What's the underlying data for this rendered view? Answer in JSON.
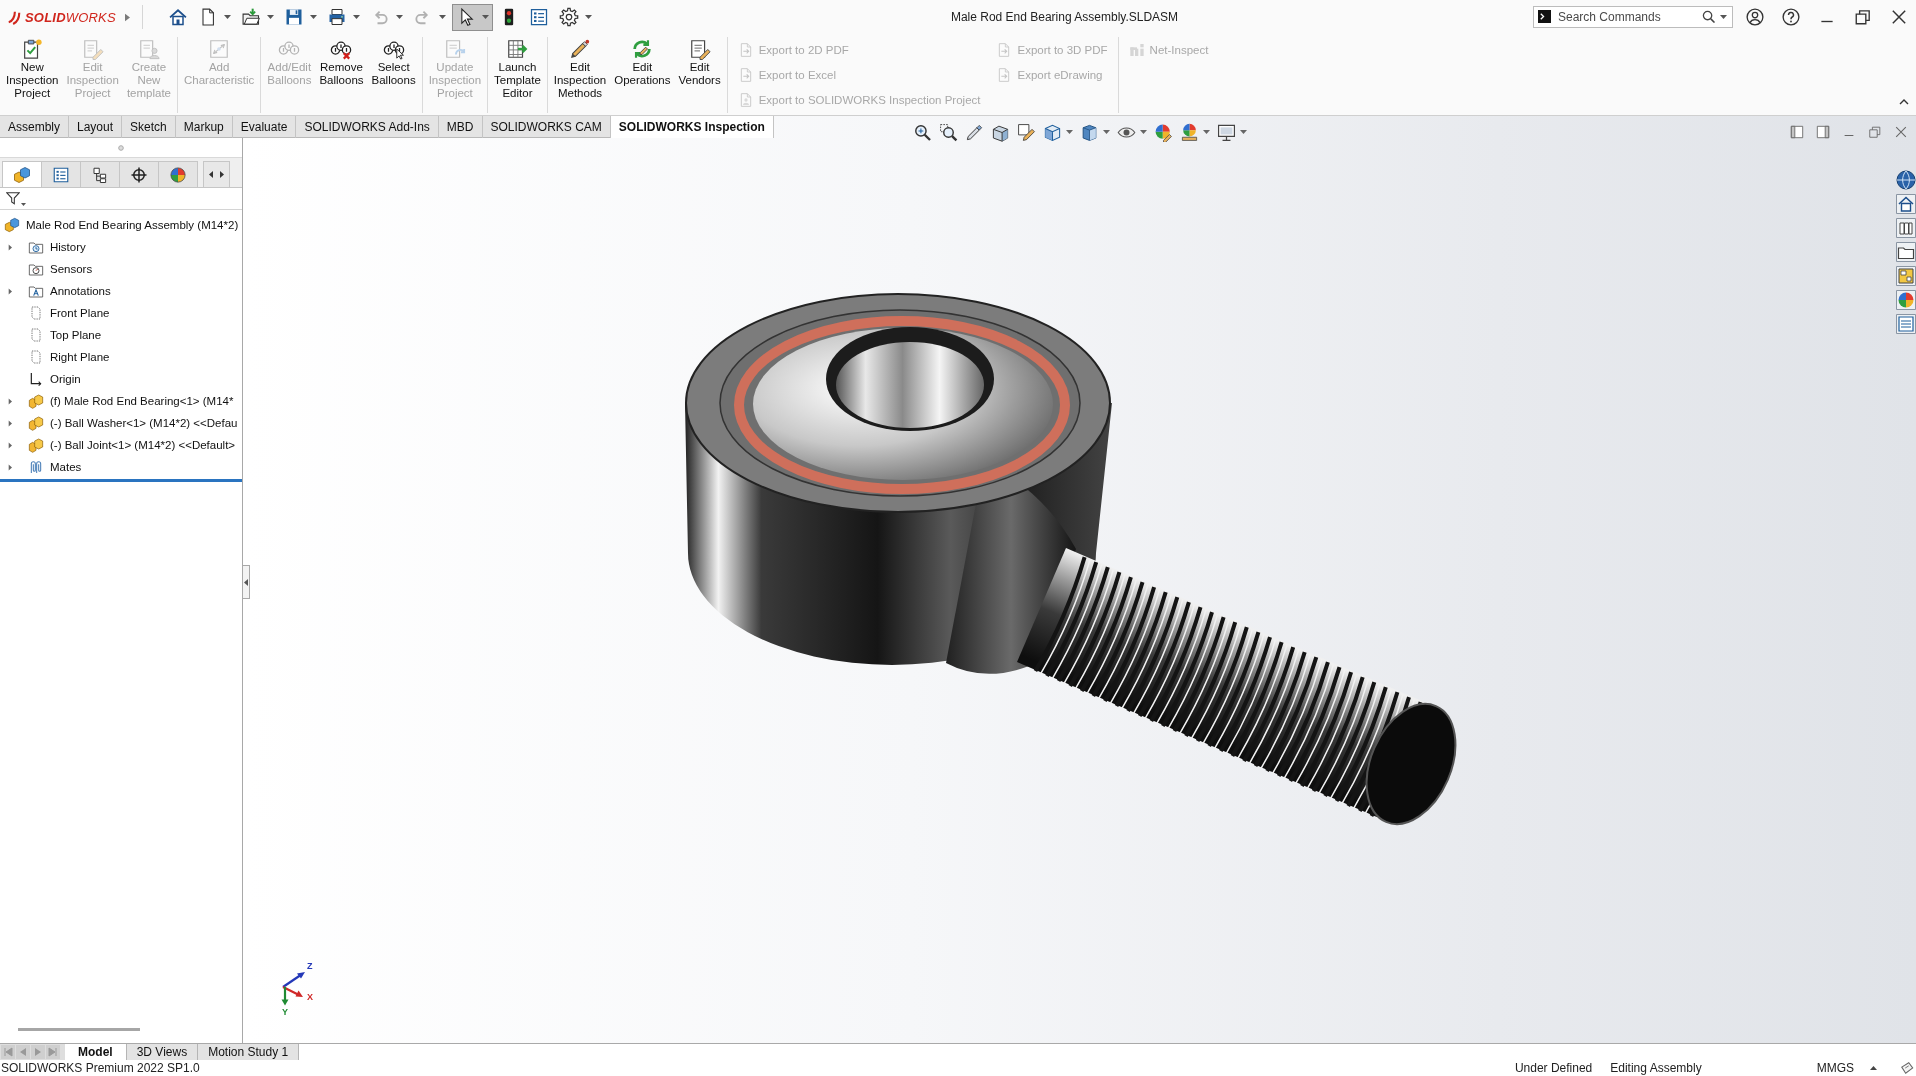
{
  "title_bar": {
    "logo": "**SOLID**WORKS",
    "title": "Male Rod End Bearing Assembly.SLDASM",
    "search": {
      "placeholder": "Search Commands"
    }
  },
  "quick_access": [
    {
      "kind": "home",
      "dropdown": false,
      "disabled": false,
      "selected": false
    },
    {
      "kind": "new",
      "dropdown": true,
      "disabled": false,
      "selected": false
    },
    {
      "kind": "open",
      "dropdown": true,
      "disabled": false,
      "selected": false
    },
    {
      "kind": "save",
      "dropdown": true,
      "disabled": false,
      "selected": false
    },
    {
      "kind": "print",
      "dropdown": true,
      "disabled": false,
      "selected": false
    },
    {
      "kind": "undo",
      "dropdown": true,
      "disabled": true,
      "selected": false
    },
    {
      "kind": "redo",
      "dropdown": true,
      "disabled": true,
      "selected": false
    },
    {
      "kind": "select",
      "dropdown": true,
      "disabled": false,
      "selected": true
    },
    {
      "kind": "rebuild",
      "dropdown": false,
      "disabled": false,
      "selected": false
    },
    {
      "kind": "properties",
      "dropdown": false,
      "disabled": false,
      "selected": false
    },
    {
      "kind": "options",
      "dropdown": true,
      "disabled": false,
      "selected": false
    }
  ],
  "ribbon": {
    "groups": [
      {
        "kind": "large",
        "buttons": [
          {
            "kind": "project",
            "lines": [
              "New",
              "Inspection",
              "Project"
            ],
            "disabled": false
          },
          {
            "kind": "edit",
            "lines": [
              "Edit",
              "Inspection",
              "Project"
            ],
            "disabled": true
          },
          {
            "kind": "template",
            "lines": [
              "Create",
              "New",
              "template"
            ],
            "disabled": true
          }
        ]
      },
      {
        "kind": "large",
        "buttons": [
          {
            "kind": "characteristic",
            "lines": [
              "Add",
              "Characteristic"
            ],
            "disabled": true
          }
        ]
      },
      {
        "kind": "large",
        "buttons": [
          {
            "kind": "balloons",
            "lines": [
              "Add/Edit",
              "Balloons"
            ],
            "disabled": true
          },
          {
            "kind": "remove",
            "lines": [
              "Remove",
              "Balloons"
            ],
            "disabled": false
          },
          {
            "kind": "select",
            "lines": [
              "Select",
              "Balloons"
            ],
            "disabled": false
          }
        ]
      },
      {
        "kind": "large",
        "buttons": [
          {
            "kind": "update",
            "lines": [
              "Update",
              "Inspection",
              "Project"
            ],
            "disabled": true
          }
        ]
      },
      {
        "kind": "large",
        "buttons": [
          {
            "kind": "launch",
            "lines": [
              "Launch",
              "Template",
              "Editor"
            ],
            "disabled": false
          }
        ]
      },
      {
        "kind": "large",
        "buttons": [
          {
            "kind": "methods",
            "lines": [
              "Edit",
              "Inspection",
              "Methods"
            ],
            "disabled": false
          },
          {
            "kind": "operations",
            "lines": [
              "Edit",
              "Operations"
            ],
            "disabled": false
          },
          {
            "kind": "vendors",
            "lines": [
              "Edit",
              "Vendors"
            ],
            "disabled": false
          }
        ]
      },
      {
        "kind": "small",
        "columns": [
          [
            {
              "kind": "pdf",
              "label": "Export to 2D PDF",
              "disabled": true
            },
            {
              "kind": "excel",
              "label": "Export to Excel",
              "disabled": true
            },
            {
              "kind": "export",
              "label": "Export to SOLIDWORKS Inspection Project",
              "disabled": true
            }
          ],
          [
            {
              "kind": "pdf",
              "label": "Export to 3D PDF",
              "disabled": true
            },
            {
              "kind": "edrawing",
              "label": "Export eDrawing",
              "disabled": true
            }
          ]
        ]
      },
      {
        "kind": "small",
        "columns": [
          [
            {
              "kind": "netinspect",
              "label": "Net-Inspect",
              "disabled": true
            }
          ]
        ]
      }
    ]
  },
  "command_tabs": [
    {
      "label": "Assembly",
      "selected": false
    },
    {
      "label": "Layout",
      "selected": false
    },
    {
      "label": "Sketch",
      "selected": false
    },
    {
      "label": "Markup",
      "selected": false
    },
    {
      "label": "Evaluate",
      "selected": false
    },
    {
      "label": "SOLIDWORKS Add-Ins",
      "selected": false
    },
    {
      "label": "MBD",
      "selected": false
    },
    {
      "label": "SOLIDWORKS CAM",
      "selected": false
    },
    {
      "label": "SOLIDWORKS Inspection",
      "selected": true
    }
  ],
  "feature_manager": {
    "tabs": [
      {
        "kind": "features",
        "selected": true
      },
      {
        "kind": "properties",
        "selected": false
      },
      {
        "kind": "configurations",
        "selected": false
      },
      {
        "kind": "dimxpert",
        "selected": false
      },
      {
        "kind": "display",
        "selected": false
      }
    ],
    "tree": [
      {
        "label": "Male Rod End Bearing Assembly (M14*2)",
        "kind": "assembly",
        "children": [
          {
            "label": "History",
            "kind": "history",
            "expanded": false
          },
          {
            "label": "Sensors",
            "kind": "sensors"
          },
          {
            "label": "Annotations",
            "kind": "annotations",
            "expanded": false
          },
          {
            "label": "Front Plane",
            "kind": "plane"
          },
          {
            "label": "Top Plane",
            "kind": "plane"
          },
          {
            "label": "Right Plane",
            "kind": "plane"
          },
          {
            "label": "Origin",
            "kind": "origin"
          },
          {
            "label": "(f) Male Rod End Bearing<1> (M14*",
            "kind": "component",
            "expanded": false
          },
          {
            "label": "(-) Ball Washer<1> (M14*2) <<Defau",
            "kind": "component",
            "expanded": false
          },
          {
            "label": "(-) Ball Joint<1> (M14*2) <<Default>",
            "kind": "component",
            "expanded": false
          },
          {
            "label": "Mates",
            "kind": "mates",
            "expanded": false
          }
        ]
      }
    ]
  },
  "triad": [
    {
      "label": "Z",
      "color": "#2438b8"
    },
    {
      "label": "X",
      "color": "#d02828"
    },
    {
      "label": "Y",
      "color": "#1f8a32"
    }
  ],
  "model_tabs": [
    {
      "label": "Model",
      "selected": true
    },
    {
      "label": "3D Views",
      "selected": false
    },
    {
      "label": "Motion Study 1",
      "selected": false
    }
  ],
  "status_bar": {
    "product": "SOLIDWORKS Premium 2022 SP1.0",
    "definition": "Under Defined",
    "mode": "Editing Assembly",
    "units": "MMGS"
  }
}
